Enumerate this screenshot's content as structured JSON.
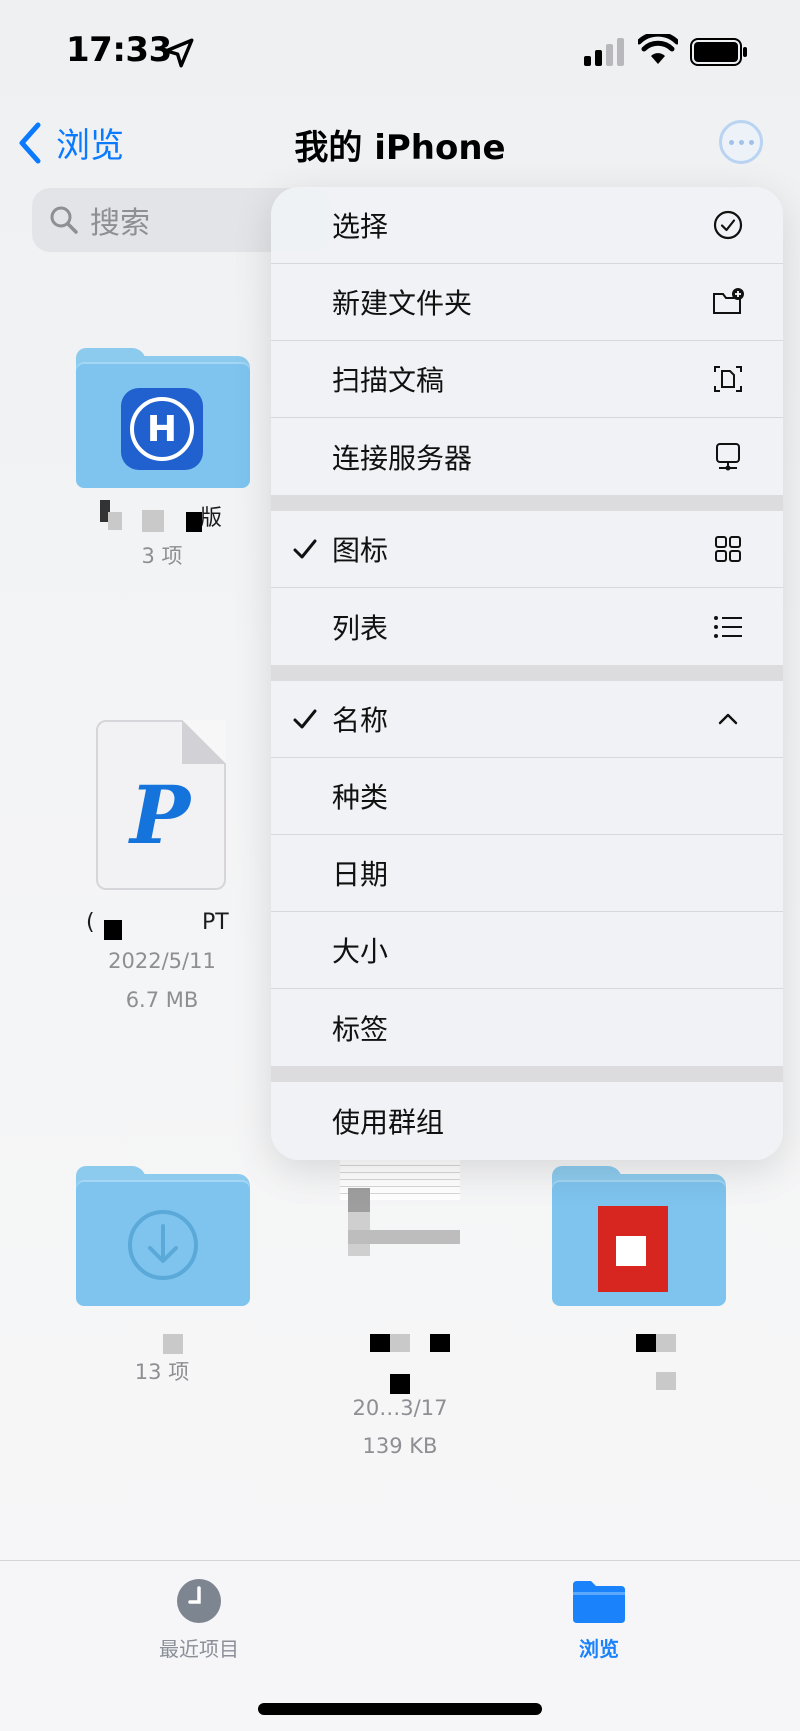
{
  "status": {
    "time": "17:33"
  },
  "nav": {
    "back_label": "浏览",
    "title": "我的 iPhone"
  },
  "search": {
    "placeholder": "搜索"
  },
  "items": [
    {
      "name": "软件…版",
      "label_visible": "版",
      "sub": "3 项"
    },
    {
      "name": "…PT",
      "label_visible": "PT",
      "date": "2022/5/11",
      "size": "6.7 MB"
    },
    {
      "name": "下载",
      "sub": "13 项"
    },
    {
      "name": "…",
      "date": "20…3/17",
      "size": "139 KB"
    },
    {
      "name": "…"
    }
  ],
  "menu": {
    "actions": [
      {
        "label": "选择",
        "icon": "checkmark-circle-icon"
      },
      {
        "label": "新建文件夹",
        "icon": "folder-badge-plus-icon"
      },
      {
        "label": "扫描文稿",
        "icon": "doc-viewfinder-icon"
      },
      {
        "label": "连接服务器",
        "icon": "display-network-icon"
      }
    ],
    "view": [
      {
        "label": "图标",
        "checked": true,
        "icon": "square-grid-icon"
      },
      {
        "label": "列表",
        "checked": false,
        "icon": "list-bullet-icon"
      }
    ],
    "sort": [
      {
        "label": "名称",
        "checked": true,
        "icon": "chevron-up-icon"
      },
      {
        "label": "种类"
      },
      {
        "label": "日期"
      },
      {
        "label": "大小"
      },
      {
        "label": "标签"
      }
    ],
    "group": {
      "label": "使用群组"
    }
  },
  "tabbar": {
    "recents": "最近项目",
    "browse": "浏览"
  },
  "colors": {
    "accent": "#0a7aff",
    "folder": "#7ec4ee"
  }
}
